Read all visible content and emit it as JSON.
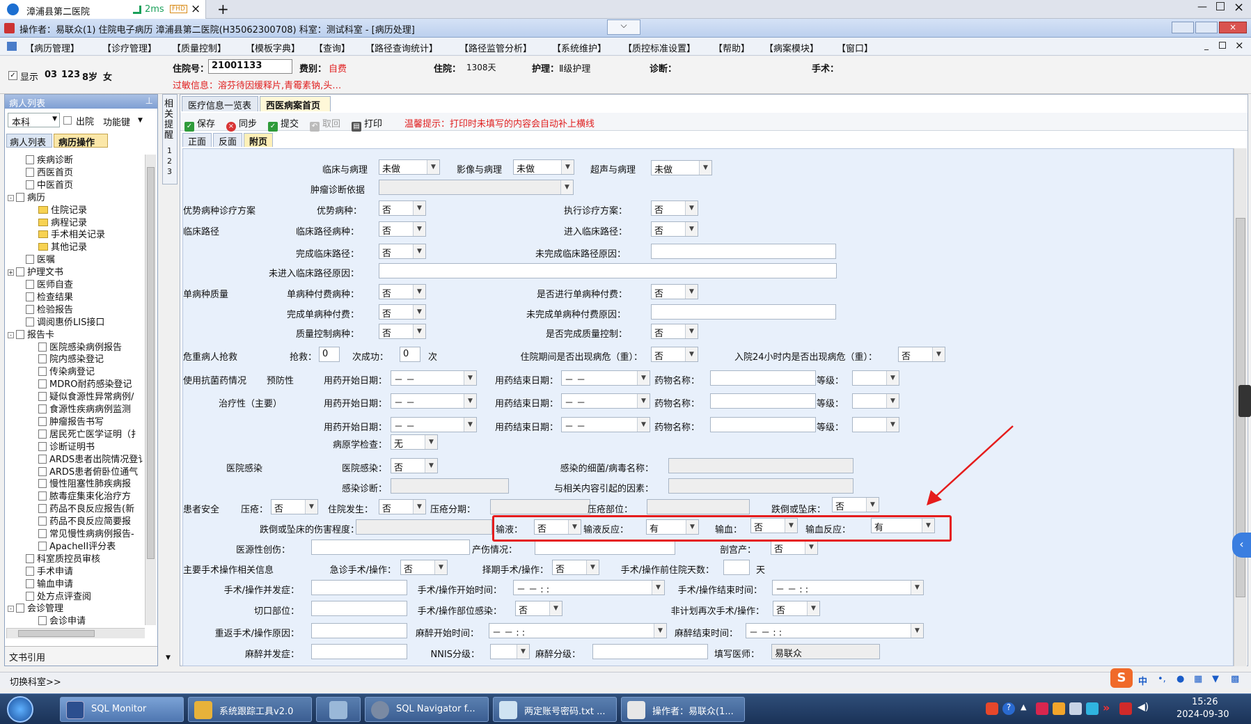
{
  "browser": {
    "tab_title": "漳浦县第二医院",
    "latency": "2ms",
    "badge": "FHD"
  },
  "window": {
    "title": "操作者：易联众(1) 住院电子病历  漳浦县第二医院(H35062300708)  科室：测试科室 - [病历处理]"
  },
  "menu": [
    "【病历管理】",
    "【诊疗管理】",
    "【质量控制】",
    "【模板字典】",
    "【查询】",
    "【路径查询统计】",
    "【路径监管分析】",
    "【系统维护】",
    "【质控标准设置】",
    "【帮助】",
    "【病案模块】",
    "【窗口】"
  ],
  "patient": {
    "show_label": "显示",
    "bed": "03",
    "id_short": "123",
    "age": "8岁",
    "sex": "女",
    "admission_no_label": "住院号：",
    "admission_no": "21001133",
    "fee_label": "费别：",
    "fee": "自费",
    "stay_label": "住院：",
    "stay": "1308天",
    "nursing_label": "护理：",
    "nursing": "Ⅱ级护理",
    "diagnosis_label": "诊断：",
    "surgery_label": "手术：",
    "allergy": "过敏信息：溶芬待因缓释片,青霉素钠,头…"
  },
  "left": {
    "title": "病人列表",
    "dept": "本科",
    "discharge": "出院",
    "func": "功能键",
    "tabs": [
      "病人列表",
      "病历操作"
    ],
    "tree": [
      {
        "t": "疾病诊断",
        "l": 1,
        "i": "doc"
      },
      {
        "t": "西医首页",
        "l": 1,
        "i": "doc"
      },
      {
        "t": "中医首页",
        "l": 1,
        "i": "doc"
      },
      {
        "t": "病历",
        "l": 0,
        "i": "doc",
        "e": "-"
      },
      {
        "t": "住院记录",
        "l": 2,
        "i": "folder"
      },
      {
        "t": "病程记录",
        "l": 2,
        "i": "folder"
      },
      {
        "t": "手术相关记录",
        "l": 2,
        "i": "folder"
      },
      {
        "t": "其他记录",
        "l": 2,
        "i": "folder"
      },
      {
        "t": "医嘱",
        "l": 1,
        "i": "doc"
      },
      {
        "t": "护理文书",
        "l": 0,
        "i": "doc",
        "e": "+"
      },
      {
        "t": "医师自查",
        "l": 1,
        "i": "doc"
      },
      {
        "t": "检查结果",
        "l": 1,
        "i": "doc"
      },
      {
        "t": "检验报告",
        "l": 1,
        "i": "doc"
      },
      {
        "t": "调阅惠侨LIS接口",
        "l": 1,
        "i": "doc"
      },
      {
        "t": "报告卡",
        "l": 0,
        "i": "doc",
        "e": "-"
      },
      {
        "t": "医院感染病例报告",
        "l": 2,
        "i": "doc"
      },
      {
        "t": "院内感染登记",
        "l": 2,
        "i": "doc"
      },
      {
        "t": "传染病登记",
        "l": 2,
        "i": "doc"
      },
      {
        "t": "MDRO耐药感染登记",
        "l": 2,
        "i": "doc"
      },
      {
        "t": "疑似食源性异常病例/",
        "l": 2,
        "i": "doc"
      },
      {
        "t": "食源性疾病病例监测",
        "l": 2,
        "i": "doc"
      },
      {
        "t": "肿瘤报告书写",
        "l": 2,
        "i": "doc"
      },
      {
        "t": "居民死亡医学证明（扌",
        "l": 2,
        "i": "doc"
      },
      {
        "t": "诊断证明书",
        "l": 2,
        "i": "doc"
      },
      {
        "t": "ARDS患者出院情况登讠",
        "l": 2,
        "i": "doc"
      },
      {
        "t": "ARDS患者俯卧位通气",
        "l": 2,
        "i": "doc"
      },
      {
        "t": "慢性阻塞性肺疾病报",
        "l": 2,
        "i": "doc"
      },
      {
        "t": "脓毒症集束化治疗方",
        "l": 2,
        "i": "doc"
      },
      {
        "t": "药品不良反应报告(新",
        "l": 2,
        "i": "doc"
      },
      {
        "t": "药品不良反应简要报",
        "l": 2,
        "i": "doc"
      },
      {
        "t": "常见慢性病病例报告-",
        "l": 2,
        "i": "doc"
      },
      {
        "t": "ApacheII评分表",
        "l": 2,
        "i": "doc"
      },
      {
        "t": "科室质控员审核",
        "l": 1,
        "i": "doc"
      },
      {
        "t": "手术申请",
        "l": 1,
        "i": "doc"
      },
      {
        "t": "输血申请",
        "l": 1,
        "i": "doc"
      },
      {
        "t": "处方点评查阅",
        "l": 1,
        "i": "doc"
      },
      {
        "t": "会诊管理",
        "l": 0,
        "i": "doc",
        "e": "-"
      },
      {
        "t": "会诊申请",
        "l": 2,
        "i": "doc"
      }
    ],
    "footer": "文书引用"
  },
  "side_tab": "相关提醒",
  "side_nums": [
    "1",
    "2",
    "3"
  ],
  "tabs": [
    "医疗信息一览表",
    "西医病案首页"
  ],
  "toolbar": {
    "save": "保存",
    "sync": "同步",
    "submit": "提交",
    "cancel": "取回",
    "print": "打印",
    "tip": "温馨提示：打印时未填写的内容会自动补上横线"
  },
  "subtabs": [
    "正面",
    "反面",
    "附页"
  ],
  "labels": {
    "l_clinic_path": "临床与病理",
    "l_image_path": "影像与病理",
    "l_us_path": "超声与病理",
    "l_tumor_basis": "肿瘤诊断依据",
    "s_adv": "优势病种诊疗方案",
    "l_adv": "优势病种：",
    "l_exec": "执行诊疗方案：",
    "s_cp": "临床路径",
    "l_cp": "临床路径病种：",
    "l_cp_in": "进入临床路径：",
    "l_cp_done": "完成临床路径：",
    "l_cp_unfin": "未完成临床路径原因：",
    "l_cp_notin": "未进入临床路径原因：",
    "s_sd": "单病种质量",
    "l_sd_pay": "单病种付费病种：",
    "l_sd_do": "是否进行单病种付费：",
    "l_sd_done": "完成单病种付费：",
    "l_sd_unfin": "未完成单病种付费原因：",
    "l_qc": "质量控制病种：",
    "l_qc_done": "是否完成质量控制：",
    "s_rescue": "危重病人抢救",
    "l_rescue": "抢救：",
    "u_times": "次",
    "l_success": "成功：",
    "u_times2": "次",
    "l_crit": "住院期间是否出现病危（重）：",
    "l_crit24": "入院24小时内是否出现病危（重）：",
    "s_abx": "使用抗菌药情况",
    "s_prev": "预防性",
    "s_treat": "治疗性（主要）",
    "l_start": "用药开始日期：",
    "l_end": "用药结束日期：",
    "l_drug": "药物名称：",
    "l_grade": "等级：",
    "l_etiology": "病原学检查：",
    "s_infect": "医院感染",
    "l_infect": "医院感染：",
    "l_bug": "感染的细菌/病毒名称：",
    "l_infdx": "感染诊断：",
    "l_cause": "与相关内容引起的因素：",
    "s_safety": "患者安全",
    "l_ulcer": "压疮：",
    "l_inhosp": "住院发生：",
    "l_stage": "压疮分期：",
    "l_site": "压疮部位：",
    "l_fall": "跌倒或坠床：",
    "l_fall_inj": "跌倒或坠床的伤害程度：",
    "l_infusion": "输液：",
    "l_inf_react": "输液反应：",
    "l_trans": "输血：",
    "l_trans_react": "输血反应：",
    "l_iatro": "医源性创伤：",
    "l_birth": "产伤情况：",
    "l_csec": "剖宫产：",
    "s_op": "主要手术操作相关信息",
    "l_emerg": "急诊手术/操作：",
    "l_elect": "择期手术/操作：",
    "l_preop": "手术/操作前住院天数：",
    "u_day": "天",
    "l_comp": "手术/操作并发症：",
    "l_opstart": "手术/操作开始时间：",
    "l_opend": "手术/操作结束时间：",
    "l_incision": "切口部位：",
    "l_sitinf": "手术/操作部位感染：",
    "l_unplan": "非计划再次手术/操作：",
    "l_reop": "重返手术/操作原因：",
    "l_anstart": "麻醉开始时间：",
    "l_anend": "麻醉结束时间：",
    "l_ancomp": "麻醉并发症：",
    "l_nnis": "NNIS分级：",
    "l_angrade": "麻醉分级：",
    "l_doctor": "填写医师："
  },
  "values": {
    "no": "否",
    "none_done": "未做",
    "none": "无",
    "yes": "有",
    "zero": "0",
    "date_blank": "－  －",
    "dt_blank": "－  －      :    :",
    "doctor": "易联众"
  },
  "status_left": "切换科室>>",
  "taskbar": [
    "SQL Monitor",
    "系统跟踪工具v2.0",
    "",
    "SQL Navigator f...",
    "两定账号密码.txt ...",
    "操作者：易联众(1..."
  ],
  "clock": {
    "time": "15:26",
    "date": "2024-09-30"
  },
  "colors": {
    "warn": "#e02020",
    "highlight": "#e51c1c"
  }
}
